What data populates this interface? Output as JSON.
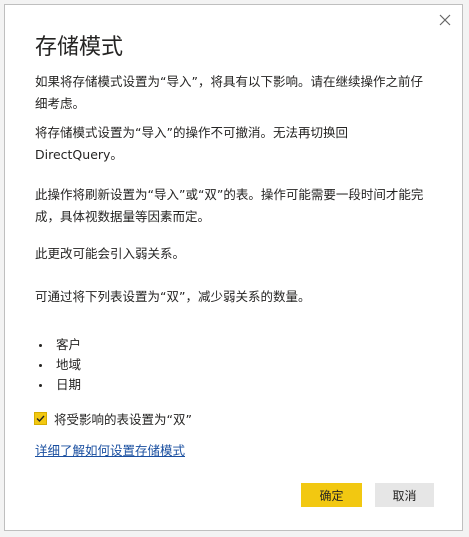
{
  "dialog": {
    "title": "存储模式",
    "paragraphs": [
      "如果将存储模式设置为“导入”，将具有以下影响。请在继续操作之前仔细考虑。",
      "将存储模式设置为“导入”的操作不可撤消。无法再切换回 DirectQuery。",
      "此操作将刷新设置为“导入”或“双”的表。操作可能需要一段时间才能完成，具体视数据量等因素而定。",
      "此更改可能会引入弱关系。",
      "可通过将下列表设置为“双”，减少弱关系的数量。"
    ],
    "tables": [
      "客户",
      "地域",
      "日期"
    ],
    "checkbox": {
      "label": "将受影响的表设置为“双”",
      "checked": true
    },
    "link_text": "详细了解如何设置存储模式",
    "ok_label": "确定",
    "cancel_label": "取消"
  },
  "colors": {
    "accent": "#f2c811",
    "link": "#1a4fa0",
    "text": "#252423"
  },
  "icons": {
    "close": "close-icon",
    "check": "check-icon"
  }
}
